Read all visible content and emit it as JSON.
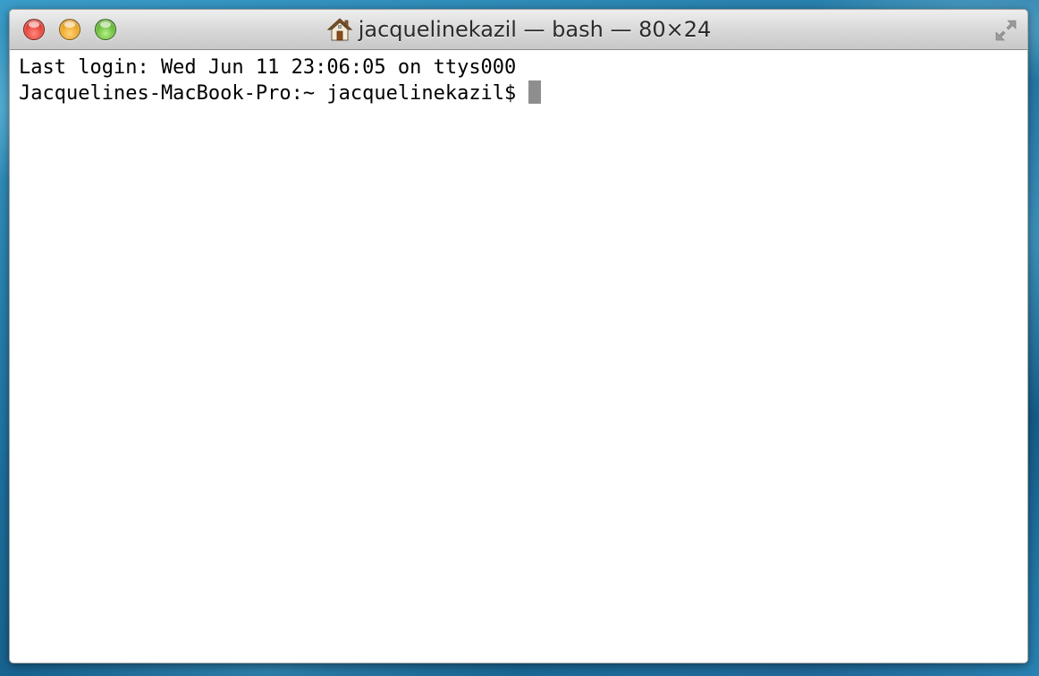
{
  "window": {
    "title": "jacquelinekazil — bash — 80×24",
    "buttons": {
      "close_icon": "close-icon",
      "minimize_icon": "minimize-icon",
      "zoom_icon": "zoom-icon",
      "fullscreen_icon": "fullscreen-icon"
    },
    "title_icon": "home-icon",
    "colors": {
      "close": "#e0392d",
      "minimize": "#e9a21d",
      "zoom": "#5fb52d",
      "cursor": "#8e8e8e",
      "terminal_bg": "#ffffff",
      "terminal_text": "#000000"
    }
  },
  "terminal": {
    "lines": [
      "Last login: Wed Jun 11 23:06:05 on ttys000",
      "Jacquelines-MacBook-Pro:~ jacquelinekazil$"
    ]
  }
}
